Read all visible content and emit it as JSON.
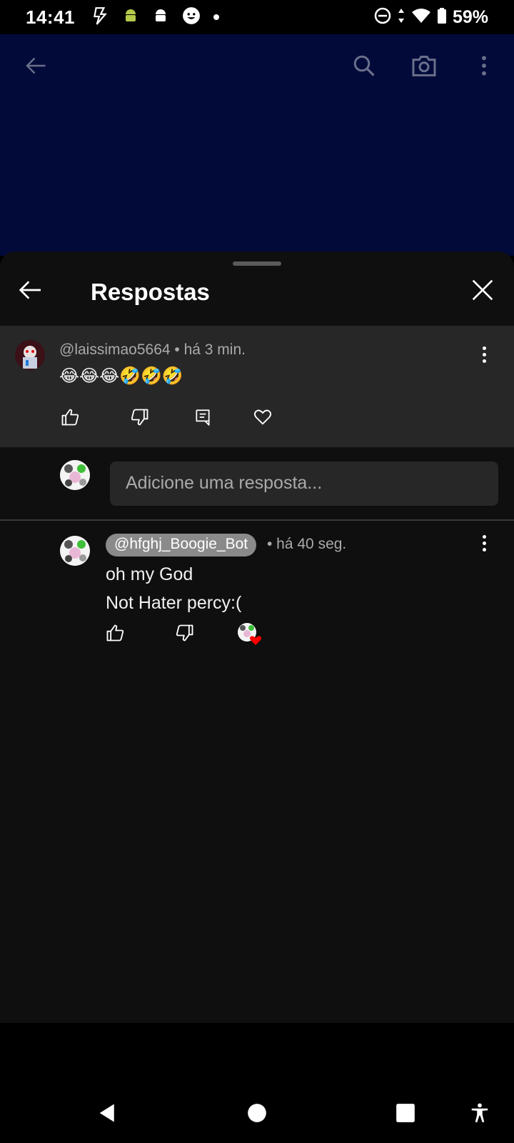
{
  "status_bar": {
    "time": "14:41",
    "battery_percent": "59%",
    "left_icons": [
      "flash-icon",
      "android-debug-icon",
      "android-icon",
      "smiley-icon",
      "dot-icon"
    ],
    "right_icons": [
      "do-not-disturb-icon",
      "data-arrows-icon",
      "wifi-icon",
      "battery-icon"
    ]
  },
  "appbar": {
    "icons": [
      "back-arrow-icon",
      "search-icon",
      "camera-icon",
      "more-vert-icon"
    ]
  },
  "sheet": {
    "title": "Respostas"
  },
  "parent_comment": {
    "author": "@laissimao5664",
    "time": "• há 3 min.",
    "text": "😂😂😂🤣🤣🤣"
  },
  "reply_box": {
    "placeholder": "Adicione uma resposta..."
  },
  "reply": {
    "author": "@hfghj_Boogie_Bot",
    "time": "• há 40 seg.",
    "line1": "oh my God",
    "line2": "Not Hater percy:("
  },
  "colors": {
    "sheet_bg": "#0f0f0f",
    "parent_bg": "#272727",
    "appbar_bg": "#020a3a",
    "heart_red": "#ff0000"
  }
}
